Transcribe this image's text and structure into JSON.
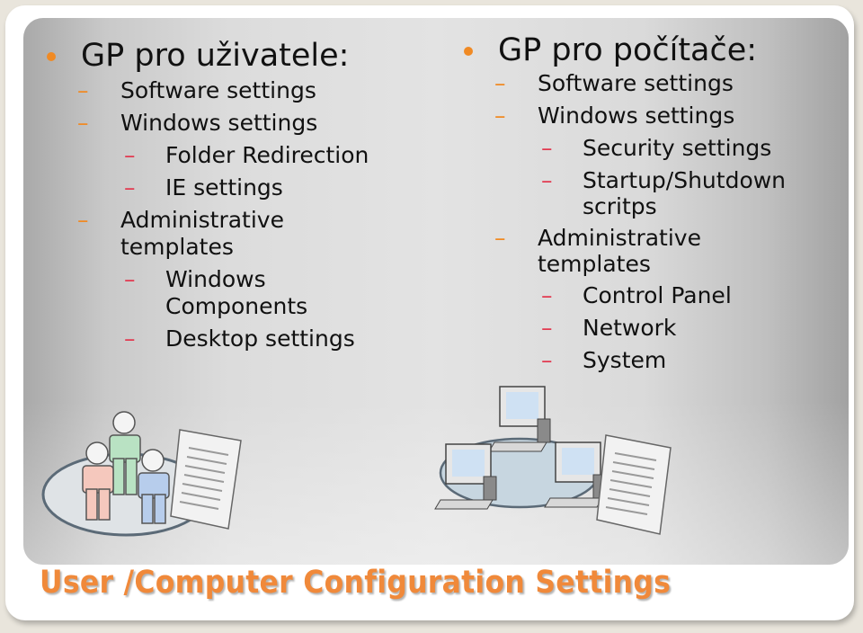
{
  "slide": {
    "title": "User /Computer Configuration Settings",
    "accent_color": "#f0893a",
    "level2_dash_color": "#f08a24",
    "level3_dash_color": "#e23a50",
    "left_column": {
      "heading": "GP pro uživatele:",
      "items": [
        {
          "label": "Software settings",
          "children": []
        },
        {
          "label": "Windows settings",
          "children": [
            "Folder Redirection",
            "IE settings"
          ]
        },
        {
          "label": "Administrative templates",
          "children": [
            "Windows Components",
            "Desktop settings"
          ]
        }
      ]
    },
    "right_column": {
      "heading": "GP pro počítače:",
      "items": [
        {
          "label": "Software settings",
          "children": []
        },
        {
          "label": "Windows settings",
          "children": [
            "Security settings",
            "Startup/Shutdown scritps"
          ]
        },
        {
          "label": "Administrative templates",
          "children": [
            "Control Panel",
            "Network",
            "System"
          ]
        }
      ]
    },
    "illustrations": {
      "left": "users-group-with-policy-scroll",
      "right": "networked-computers-with-policy-scroll"
    },
    "dash_glyph": "–"
  }
}
